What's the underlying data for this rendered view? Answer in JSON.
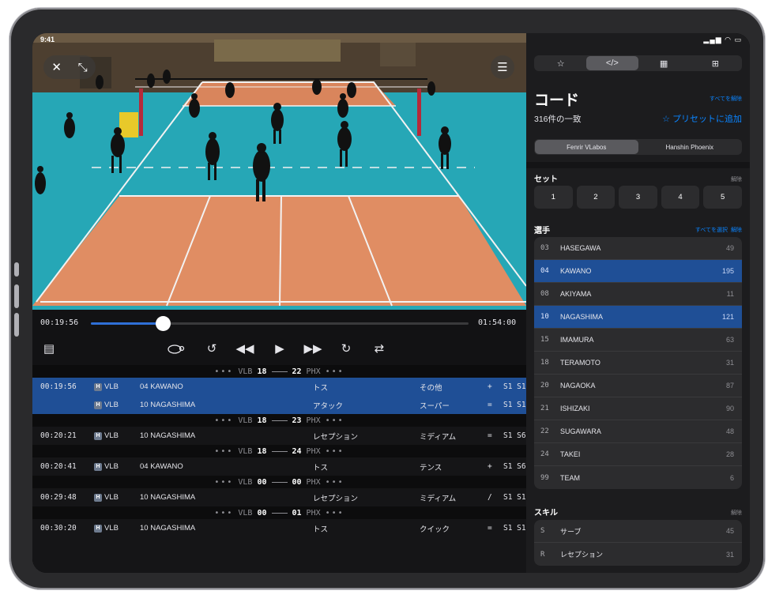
{
  "status": {
    "time": "9:41",
    "icons": "signal wifi battery"
  },
  "video": {
    "close_icon": "close-icon",
    "expand_icon": "expand-icon",
    "settings_icon": "sliders-icon"
  },
  "timeline": {
    "current": "00:19:56",
    "total": "01:54:00",
    "progress": 0.19
  },
  "controls": [
    {
      "name": "document-icon",
      "glyph": "🗎"
    },
    {
      "name": "slow-motion-icon",
      "glyph": "🐢"
    },
    {
      "name": "back-3s-icon",
      "glyph": "↺"
    },
    {
      "name": "rewind-icon",
      "glyph": "◀◀"
    },
    {
      "name": "play-icon",
      "glyph": "▶"
    },
    {
      "name": "fast-forward-icon",
      "glyph": "▶▶"
    },
    {
      "name": "forward-5s-icon",
      "glyph": "↻"
    },
    {
      "name": "repeat-icon",
      "glyph": "⇄"
    }
  ],
  "log": [
    {
      "type": "score",
      "dots_l": "•••",
      "team_a": "VLB",
      "a": "18",
      "b": "22",
      "team_b": "PHX",
      "dots_r": "•••"
    },
    {
      "type": "event",
      "hl": true,
      "time": "00:19:56",
      "team": "VLB",
      "player": "04 KAWANO",
      "skill": "トス",
      "quality": "その他",
      "eval": "+",
      "rot": "S1 S1"
    },
    {
      "type": "event",
      "hl": true,
      "time": "",
      "team": "VLB",
      "player": "10 NAGASHIMA",
      "skill": "アタック",
      "quality": "スーパー",
      "eval": "=",
      "rot": "S1 S1"
    },
    {
      "type": "score",
      "dots_l": "•••",
      "team_a": "VLB",
      "a": "18",
      "b": "23",
      "team_b": "PHX",
      "dots_r": "•••"
    },
    {
      "type": "event",
      "hl": false,
      "time": "00:20:21",
      "team": "VLB",
      "player": "10 NAGASHIMA",
      "skill": "レセプション",
      "quality": "ミディアム",
      "eval": "=",
      "rot": "S1 S6"
    },
    {
      "type": "score",
      "dots_l": "•••",
      "team_a": "VLB",
      "a": "18",
      "b": "24",
      "team_b": "PHX",
      "dots_r": "•••"
    },
    {
      "type": "event",
      "hl": false,
      "time": "00:20:41",
      "team": "VLB",
      "player": "04 KAWANO",
      "skill": "トス",
      "quality": "テンス",
      "eval": "+",
      "rot": "S1 S6"
    },
    {
      "type": "score",
      "dots_l": "•••",
      "team_a": "VLB",
      "a": "00",
      "b": "00",
      "team_b": "PHX",
      "dots_r": "•••"
    },
    {
      "type": "event",
      "hl": false,
      "time": "00:29:48",
      "team": "VLB",
      "player": "10 NAGASHIMA",
      "skill": "レセプション",
      "quality": "ミディアム",
      "eval": "/",
      "rot": "S1 S1"
    },
    {
      "type": "score",
      "dots_l": "•••",
      "team_a": "VLB",
      "a": "00",
      "b": "01",
      "team_b": "PHX",
      "dots_r": "•••"
    },
    {
      "type": "event",
      "hl": false,
      "time": "00:30:20",
      "team": "VLB",
      "player": "10 NAGASHIMA",
      "skill": "トス",
      "quality": "クイック",
      "eval": "=",
      "rot": "S1 S1"
    }
  ],
  "right": {
    "tabs": [
      "☆",
      "</>",
      "▦",
      "⊞"
    ],
    "active_tab": 1,
    "title": "コード",
    "clear_all": "すべてを解除",
    "count": "316件の一致",
    "preset": "☆ プリセットに追加",
    "teams": [
      "Fenrir VLabos",
      "Hanshin Phoenix"
    ],
    "active_team": 0,
    "set_label": "セット",
    "set_clear": "解除",
    "sets": [
      "1",
      "2",
      "3",
      "4",
      "5"
    ],
    "players_label": "選手",
    "players_select_all": "すべてを選択",
    "players_clear": "解除",
    "players": [
      {
        "no": "03",
        "name": "HASEGAWA",
        "count": "49",
        "sel": false
      },
      {
        "no": "04",
        "name": "KAWANO",
        "count": "195",
        "sel": true
      },
      {
        "no": "08",
        "name": "AKIYAMA",
        "count": "11",
        "sel": false
      },
      {
        "no": "10",
        "name": "NAGASHIMA",
        "count": "121",
        "sel": true
      },
      {
        "no": "15",
        "name": "IMAMURA",
        "count": "63",
        "sel": false
      },
      {
        "no": "18",
        "name": "TERAMOTO",
        "count": "31",
        "sel": false
      },
      {
        "no": "20",
        "name": "NAGAOKA",
        "count": "87",
        "sel": false
      },
      {
        "no": "21",
        "name": "ISHIZAKI",
        "count": "90",
        "sel": false
      },
      {
        "no": "22",
        "name": "SUGAWARA",
        "count": "48",
        "sel": false
      },
      {
        "no": "24",
        "name": "TAKEI",
        "count": "28",
        "sel": false
      },
      {
        "no": "99",
        "name": "TEAM",
        "count": "6",
        "sel": false
      }
    ],
    "skills_label": "スキル",
    "skills_clear": "解除",
    "skills": [
      {
        "code": "S",
        "name": "サーブ",
        "count": "45"
      },
      {
        "code": "R",
        "name": "レセプション",
        "count": "31"
      }
    ]
  }
}
